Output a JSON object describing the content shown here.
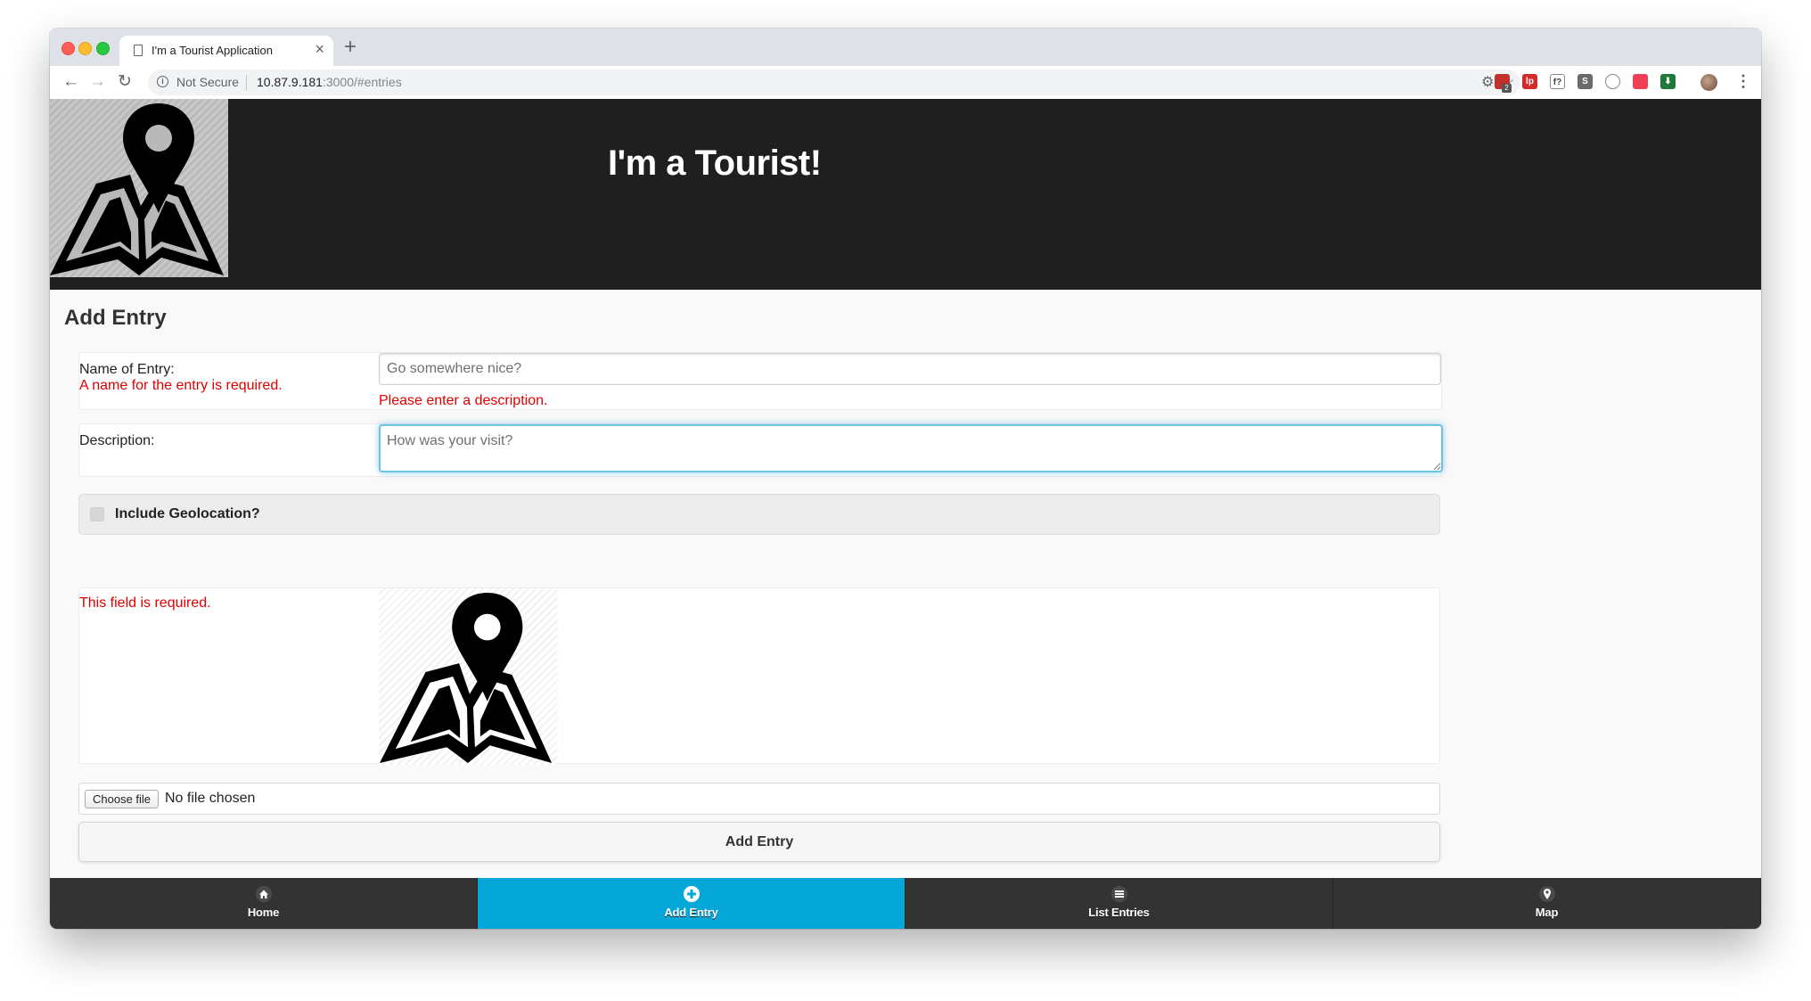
{
  "browser": {
    "tab_title": "I'm a Tourist Application",
    "tab_close": "×",
    "new_tab": "+",
    "security_label": "Not Secure",
    "url_host": "10.87.9.181",
    "url_rest": ":3000/#entries",
    "extensions": [
      {
        "name": "ublock-icon",
        "color": "#c4302b",
        "text": ""
      },
      {
        "name": "lastpass-icon",
        "color": "#d42a2a",
        "text": "lp"
      },
      {
        "name": "formula-icon",
        "color": "#ffffff",
        "text": "f?"
      },
      {
        "name": "screenshot-icon",
        "color": "#6b6b6b",
        "text": "S"
      },
      {
        "name": "circle-ext-icon",
        "color": "#ffffff",
        "text": ""
      },
      {
        "name": "pocket-icon",
        "color": "#ef4056",
        "text": ""
      },
      {
        "name": "download-ext-icon",
        "color": "#1f7a3a",
        "text": "⬇"
      }
    ],
    "ublock_badge": "2"
  },
  "header": {
    "title": "I'm a Tourist!"
  },
  "form": {
    "page_title": "Add Entry",
    "name_label": "Name of Entry:",
    "name_error": "A name for the entry is required.",
    "name_placeholder": "Go somewhere nice?",
    "description_error": "Please enter a description.",
    "description_label": "Description:",
    "description_placeholder": "How was your visit?",
    "geolocation_label": "Include Geolocation?",
    "image_error": "This field is required.",
    "choose_file_label": "Choose file",
    "no_file_text": "No file chosen",
    "submit_label": "Add Entry"
  },
  "nav": {
    "items": [
      {
        "label": "Home",
        "icon": "home-icon",
        "active": false
      },
      {
        "label": "Add Entry",
        "icon": "plus-circle-icon",
        "active": true
      },
      {
        "label": "List Entries",
        "icon": "bars-icon",
        "active": false
      },
      {
        "label": "Map",
        "icon": "location-pin-icon",
        "active": false
      }
    ]
  },
  "colors": {
    "header_bg": "#1f1f1f",
    "nav_bg": "#333333",
    "nav_active": "#05a7d9",
    "error": "#e00000",
    "focus_ring": "#6ec3df"
  }
}
